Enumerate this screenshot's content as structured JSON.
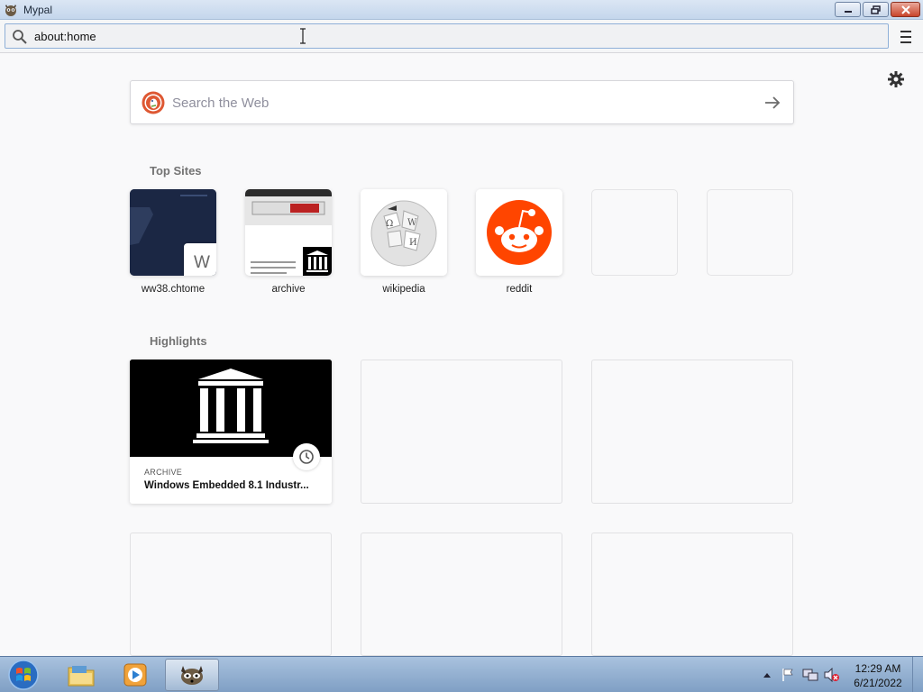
{
  "window": {
    "title": "Mypal"
  },
  "navbar": {
    "url": "about:home"
  },
  "search": {
    "placeholder": "Search the Web"
  },
  "top_sites": {
    "heading": "Top Sites",
    "items": [
      {
        "label": "ww38.chtome",
        "letter": "W"
      },
      {
        "label": "archive"
      },
      {
        "label": "wikipedia"
      },
      {
        "label": "reddit"
      }
    ]
  },
  "highlights": {
    "heading": "Highlights",
    "items": [
      {
        "source": "ARCHIVE",
        "title": "Windows Embedded 8.1 Industr..."
      }
    ]
  },
  "taskbar": {
    "time": "12:29 AM",
    "date": "6/21/2022"
  }
}
